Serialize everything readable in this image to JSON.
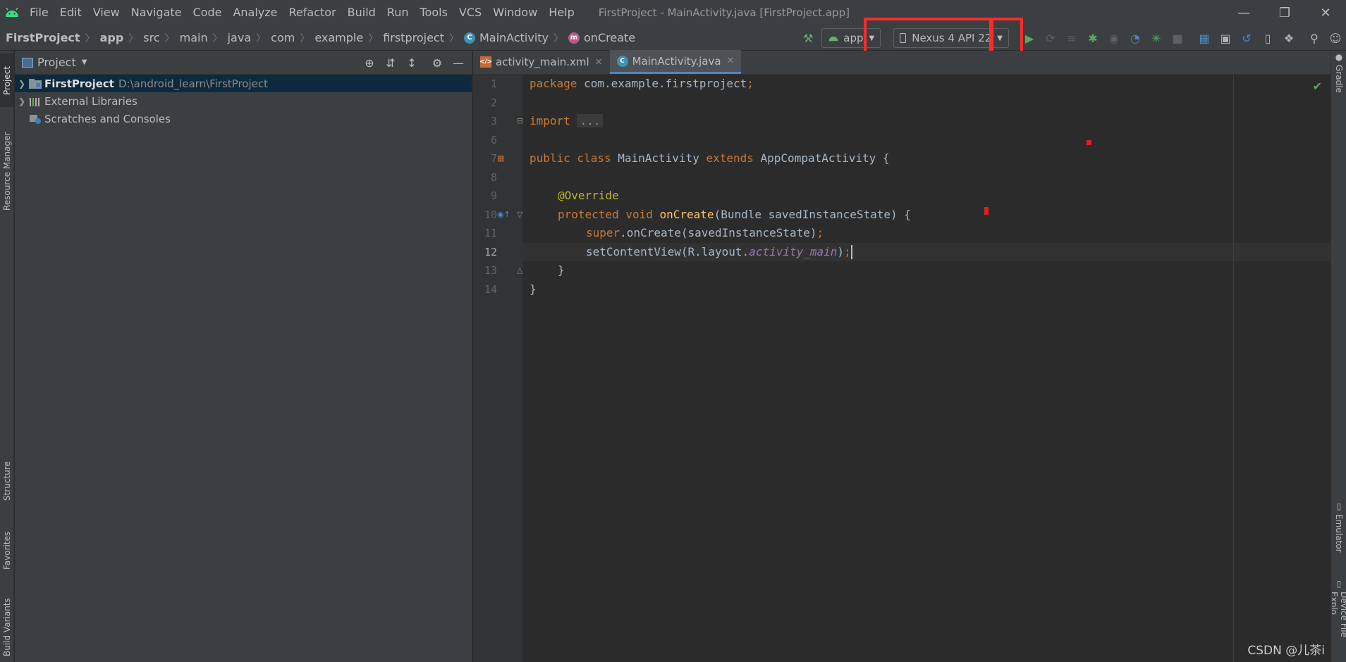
{
  "app": {
    "window_title": "FirstProject - MainActivity.java [FirstProject.app]",
    "menu": [
      "File",
      "Edit",
      "View",
      "Navigate",
      "Code",
      "Analyze",
      "Refactor",
      "Build",
      "Run",
      "Tools",
      "VCS",
      "Window",
      "Help"
    ]
  },
  "breadcrumb": {
    "items": [
      "FirstProject",
      "app",
      "src",
      "main",
      "java",
      "com",
      "example",
      "firstproject",
      "MainActivity",
      "onCreate"
    ]
  },
  "toolbar": {
    "run_config": "app",
    "device": "Nexus 4 API 22"
  },
  "left_stripe": {
    "tabs": [
      "Project",
      "Resource Manager",
      "Structure",
      "Favorites",
      "Build Variants"
    ]
  },
  "right_stripe": {
    "tabs": [
      "Gradle",
      "Emulator",
      "Device File Explo"
    ]
  },
  "project_panel": {
    "title": "Project",
    "tree": [
      {
        "label": "FirstProject",
        "path": "D:\\android_learn\\FirstProject"
      },
      {
        "label": "External Libraries",
        "path": ""
      },
      {
        "label": "Scratches and Consoles",
        "path": ""
      }
    ]
  },
  "editor": {
    "tabs": [
      "activity_main.xml",
      "MainActivity.java"
    ],
    "active_tab": "MainActivity.java",
    "line_numbers": [
      "1",
      "2",
      "3",
      "6",
      "7",
      "8",
      "9",
      "10",
      "11",
      "12",
      "13",
      "14"
    ],
    "code": {
      "l1_kw": "package",
      "l1_rest": " com.example.firstproject",
      "l1_semi": ";",
      "l3_kw": "import",
      "l3_fold": "...",
      "l7_kw1": "public class",
      "l7_name": " MainActivity ",
      "l7_kw2": "extends",
      "l7_rest": " AppCompatActivity {",
      "l9_ann": "@Override",
      "l10_kw": "protected void",
      "l10_fn": "onCreate",
      "l10_rest": "(Bundle savedInstanceState) {",
      "l11_kw": "super",
      "l11_rest": ".onCreate(savedInstanceState)",
      "l11_semi": ";",
      "l12_a": "setContentView(R.layout.",
      "l12_fld": "activity_main",
      "l12_b": ")",
      "l12_semi": ";",
      "l13": "}",
      "l14": "}"
    }
  },
  "watermark": "CSDN @儿茶i"
}
